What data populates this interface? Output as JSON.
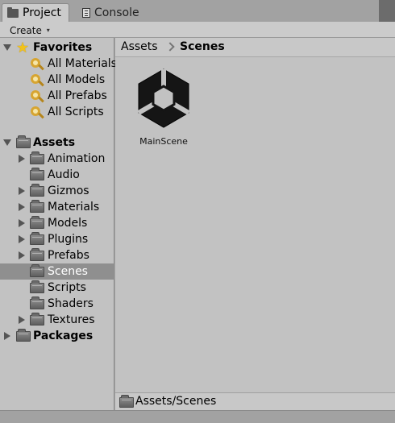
{
  "tabs": [
    {
      "label": "Project",
      "icon": "folder-icon",
      "active": true
    },
    {
      "label": "Console",
      "icon": "console-icon",
      "active": false
    }
  ],
  "toolbar": {
    "create_label": "Create",
    "create_caret": "▾"
  },
  "favorites": {
    "header": "Favorites",
    "items": [
      {
        "label": "All Materials"
      },
      {
        "label": "All Models"
      },
      {
        "label": "All Prefabs"
      },
      {
        "label": "All Scripts"
      }
    ]
  },
  "assets": {
    "header": "Assets",
    "items": [
      {
        "label": "Animation",
        "expandable": true
      },
      {
        "label": "Audio",
        "expandable": false
      },
      {
        "label": "Gizmos",
        "expandable": true
      },
      {
        "label": "Materials",
        "expandable": true
      },
      {
        "label": "Models",
        "expandable": true
      },
      {
        "label": "Plugins",
        "expandable": true
      },
      {
        "label": "Prefabs",
        "expandable": true
      },
      {
        "label": "Scenes",
        "expandable": false,
        "selected": true
      },
      {
        "label": "Scripts",
        "expandable": false
      },
      {
        "label": "Shaders",
        "expandable": false
      },
      {
        "label": "Textures",
        "expandable": true
      }
    ]
  },
  "packages": {
    "header": "Packages"
  },
  "breadcrumb": {
    "root": "Assets",
    "current": "Scenes"
  },
  "content": {
    "items": [
      {
        "name": "MainScene",
        "icon": "unity-scene-icon"
      }
    ]
  },
  "footer": {
    "path": "Assets/Scenes"
  },
  "colors": {
    "selection": "#8f8f8f",
    "panel": "#c2c2c2",
    "star": "#f2c21b",
    "search_icon": "#d7a531"
  }
}
